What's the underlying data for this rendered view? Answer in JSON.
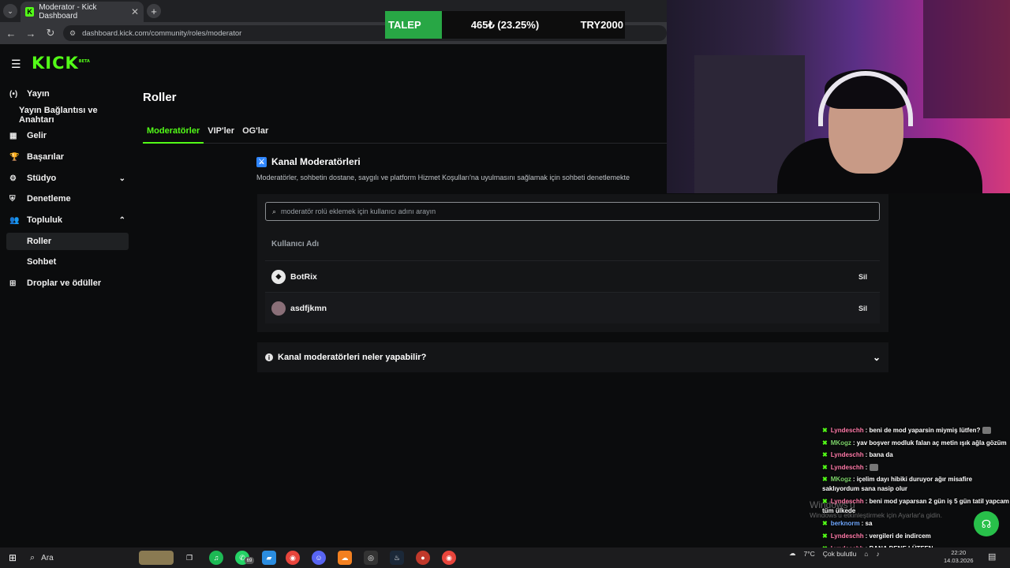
{
  "browser": {
    "tab_title": "Moderator - Kick Dashboard",
    "tab_close": "✕",
    "url": "dashboard.kick.com/community/roles/moderator"
  },
  "ticker": {
    "label": "TALEP",
    "amount": "465₺ (23.25%)",
    "goal": "TRY2000"
  },
  "brand": {
    "logo": "KICK",
    "tag": "BETA"
  },
  "sidebar": {
    "items": [
      {
        "label": "Yayın",
        "icon": "broadcast-icon",
        "glyph": "(•)"
      },
      {
        "label": "Yayın Bağlantısı ve Anahtarı"
      },
      {
        "label": "Gelir",
        "icon": "revenue-icon",
        "glyph": "▦"
      },
      {
        "label": "Başarılar",
        "icon": "trophy-icon",
        "glyph": "🏆"
      },
      {
        "label": "Stüdyo",
        "icon": "gear-icon",
        "glyph": "⚙",
        "chevron": "⌄"
      },
      {
        "label": "Denetleme",
        "icon": "shield-icon",
        "glyph": "⛨"
      },
      {
        "label": "Topluluk",
        "icon": "community-icon",
        "glyph": "👥",
        "chevron": "⌃"
      },
      {
        "label": "Roller"
      },
      {
        "label": "Sohbet"
      },
      {
        "label": "Droplar ve ödüller",
        "icon": "drops-icon",
        "glyph": "⊞"
      }
    ]
  },
  "main": {
    "title": "Roller",
    "tabs": [
      "Moderatörler",
      "VIP'ler",
      "OG'lar"
    ],
    "section_title": "Kanal Moderatörleri",
    "section_desc": "Moderatörler, sohbetin dostane, saygılı ve platform Hizmet Koşulları'na uyulmasını sağlamak için sohbeti denetlemekte",
    "search_placeholder": "moderatör rolü eklemek için kullanıcı adını arayın",
    "column_header": "Kullanıcı Adı",
    "moderators": [
      {
        "name": "BotRix",
        "action": "Sil"
      },
      {
        "name": "asdfjkmn",
        "action": "Sil"
      }
    ],
    "faq": "Kanal moderatörleri neler yapabilir?"
  },
  "chat": [
    {
      "user": "Lyndeschh",
      "color": "#ff7aa8",
      "text": ": beni de mod yaparsin miymiş lütfen?",
      "emote": true
    },
    {
      "user": "MKogz",
      "color": "#7dd36a",
      "text": ": yav boşver modluk falan aç metin ışık ağla gözüm"
    },
    {
      "user": "Lyndeschh",
      "color": "#ff7aa8",
      "text": ": bana da"
    },
    {
      "user": "Lyndeschh",
      "color": "#ff7aa8",
      "text": ":",
      "emote": true
    },
    {
      "user": "MKogz",
      "color": "#7dd36a",
      "text": ": içelim dayı hibiki duruyor ağır misafire saklıyordum sana nasip olur",
      "wrap": true
    },
    {
      "user": "Lyndeschh",
      "color": "#ff7aa8",
      "text": ": beni mod yaparsan 2 gün iş 5 gün tatil yapcam tüm ülkede",
      "wrap": true
    },
    {
      "user": "berknorm",
      "color": "#6fa8ff",
      "text": ": sa"
    },
    {
      "user": "Lyndeschh",
      "color": "#ff7aa8",
      "text": ": vergileri de indircem"
    },
    {
      "user": "Lyndeschh",
      "color": "#ff7aa8",
      "text": ": BANA DENE LÜTFEN"
    }
  ],
  "watermark": {
    "line1": "Windows'u",
    "line2": "Windows'u etkinleştirmek için Ayarlar'a gidin."
  },
  "taskbar": {
    "search_label": "Ara",
    "badge_count": "69",
    "weather": "7°C",
    "weather_desc": "Çok bulutlu",
    "time": "22:20",
    "date": "14.03.2026"
  }
}
